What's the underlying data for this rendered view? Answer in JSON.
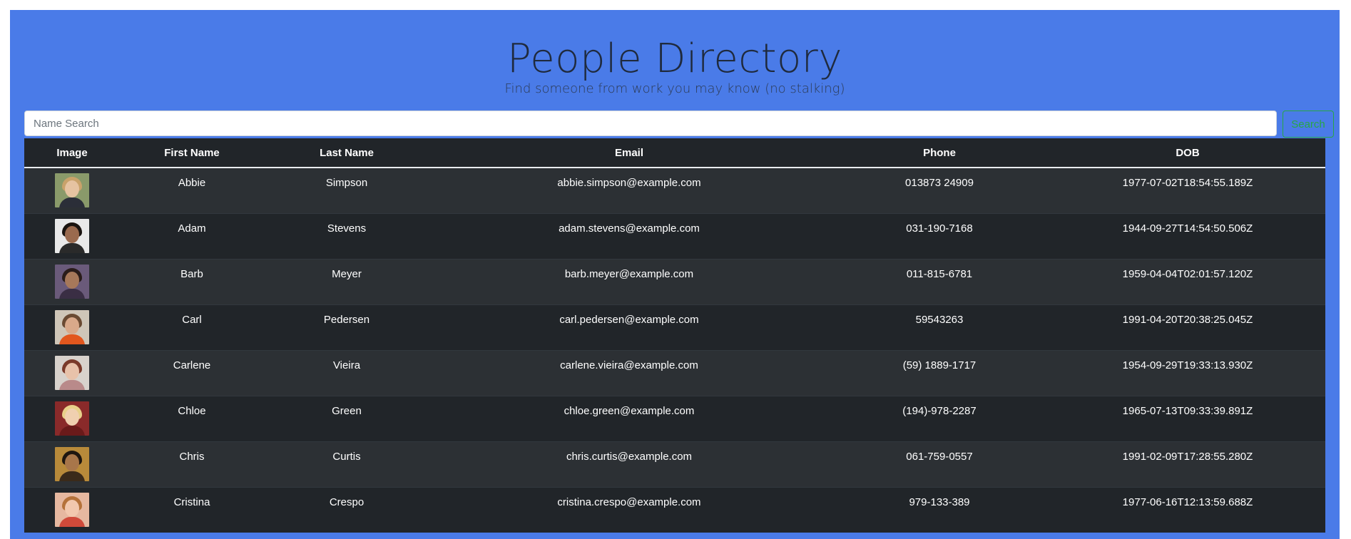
{
  "header": {
    "title": "People Directory",
    "subtitle": "Find someone from work you may know (no stalking)"
  },
  "search": {
    "placeholder": "Name Search",
    "value": "",
    "button_label": "Search"
  },
  "table": {
    "columns": [
      "Image",
      "First Name",
      "Last Name",
      "Email",
      "Phone",
      "DOB"
    ],
    "rows": [
      {
        "first": "Abbie",
        "last": "Simpson",
        "email": "abbie.simpson@example.com",
        "phone": "013873 24909",
        "dob": "1977-07-02T18:54:55.189Z",
        "avatar": {
          "bg": "#8a9a6a",
          "skin": "#e6c3a1",
          "hair": "#c9a26a",
          "shirt": "#2b2e38"
        }
      },
      {
        "first": "Adam",
        "last": "Stevens",
        "email": "adam.stevens@example.com",
        "phone": "031-190-7168",
        "dob": "1944-09-27T14:54:50.506Z",
        "avatar": {
          "bg": "#e9e9e9",
          "skin": "#9a6a4e",
          "hair": "#1a1410",
          "shirt": "#2a2a2a"
        }
      },
      {
        "first": "Barb",
        "last": "Meyer",
        "email": "barb.meyer@example.com",
        "phone": "011-815-6781",
        "dob": "1959-04-04T02:01:57.120Z",
        "avatar": {
          "bg": "#6a5a7a",
          "skin": "#a7785a",
          "hair": "#2a1c1a",
          "shirt": "#3a2e44"
        }
      },
      {
        "first": "Carl",
        "last": "Pedersen",
        "email": "carl.pedersen@example.com",
        "phone": "59543263",
        "dob": "1991-04-20T20:38:25.045Z",
        "avatar": {
          "bg": "#cfc6b8",
          "skin": "#d9a98a",
          "hair": "#6a4a32",
          "shirt": "#e2571e"
        }
      },
      {
        "first": "Carlene",
        "last": "Vieira",
        "email": "carlene.vieira@example.com",
        "phone": "(59) 1889-1717",
        "dob": "1954-09-29T19:33:13.930Z",
        "avatar": {
          "bg": "#d8d2cc",
          "skin": "#e8c2aa",
          "hair": "#7a3a2a",
          "shirt": "#b98a8a"
        }
      },
      {
        "first": "Chloe",
        "last": "Green",
        "email": "chloe.green@example.com",
        "phone": "(194)-978-2287",
        "dob": "1965-07-13T09:33:39.891Z",
        "avatar": {
          "bg": "#8a2a2a",
          "skin": "#f0d0b0",
          "hair": "#e8d08a",
          "shirt": "#6a1a1a"
        }
      },
      {
        "first": "Chris",
        "last": "Curtis",
        "email": "chris.curtis@example.com",
        "phone": "061-759-0557",
        "dob": "1991-02-09T17:28:55.280Z",
        "avatar": {
          "bg": "#b88a3a",
          "skin": "#a8764a",
          "hair": "#1e1610",
          "shirt": "#3a2a1a"
        }
      },
      {
        "first": "Cristina",
        "last": "Crespo",
        "email": "cristina.crespo@example.com",
        "phone": "979-133-389",
        "dob": "1977-06-16T12:13:59.688Z",
        "avatar": {
          "bg": "#e6b8a0",
          "skin": "#f2c8ae",
          "hair": "#b5723a",
          "shirt": "#d04a3a"
        }
      }
    ]
  }
}
